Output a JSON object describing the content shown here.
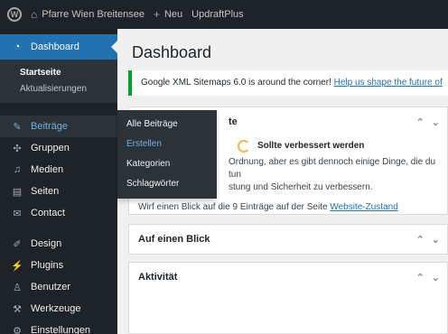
{
  "adminbar": {
    "site_name": "Pfarre Wien Breitensee",
    "new_label": "Neu",
    "plugin_label": "UpdraftPlus"
  },
  "sidebar": {
    "dashboard_label": "Dashboard",
    "sub_startseite": "Startseite",
    "sub_updates": "Aktualisierungen",
    "items": [
      {
        "label": "Beiträge",
        "icon": "pin-icon"
      },
      {
        "label": "Gruppen",
        "icon": "groups-icon"
      },
      {
        "label": "Medien",
        "icon": "media-icon"
      },
      {
        "label": "Seiten",
        "icon": "pages-icon"
      },
      {
        "label": "Contact",
        "icon": "mail-icon"
      },
      {
        "label": "Design",
        "icon": "brush-icon"
      },
      {
        "label": "Plugins",
        "icon": "plug-icon"
      },
      {
        "label": "Benutzer",
        "icon": "user-icon"
      },
      {
        "label": "Werkzeuge",
        "icon": "wrench-icon"
      },
      {
        "label": "Einstellungen",
        "icon": "settings-icon"
      }
    ]
  },
  "flyout": {
    "items": [
      "Alle Beiträge",
      "Erstellen",
      "Kategorien",
      "Schlagwörter"
    ]
  },
  "main": {
    "title": "Dashboard",
    "notice_text": "Google XML Sitemaps 6.0 is around the corner!",
    "notice_link": "Help us shape the future of",
    "health_title_fragment": "te",
    "health_status": "Sollte verbessert werden",
    "health_line1": "Ordnung, aber es gibt dennoch einige Dinge, die du tun",
    "health_line2": "stung und Sicherheit zu verbessern.",
    "health_prefix": "Wirf einen Blick auf die 9 Einträge auf der Seite",
    "health_link": "Website-Zustand",
    "glance_title": "Auf einen Blick",
    "activity_title": "Aktivität"
  },
  "colors": {
    "accent": "#2271b1",
    "notice_border": "#00a32a",
    "sidebar_bg": "#1d2327"
  }
}
